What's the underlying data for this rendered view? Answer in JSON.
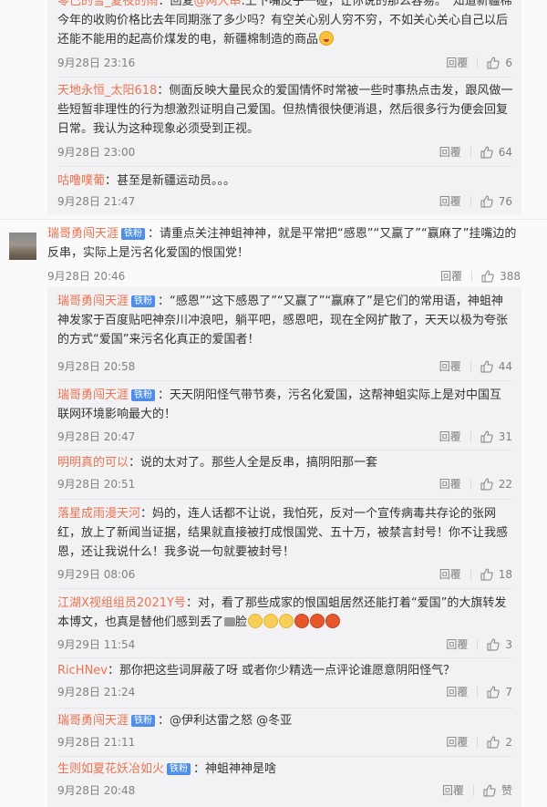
{
  "comments_top": [
    {
      "user": "零已的雪_夏夜的雨",
      "text_parts": [
        "：回复",
        "@网大串",
        ":上下嘴皮子一碰，让你说的那么容易。“知道新疆棉今年的收购价格比去年同期涨了多少吗？有空关心别人穷不穷，不如关心关心自己以后还能不能用的起高价煤发的电，新疆棉制造的商品"
      ],
      "emoji": "laugh-emoji",
      "time": "9月28日 23:16",
      "reply_label": "回覆",
      "likes": "6"
    },
    {
      "user": "天地永恒_太阳618",
      "text": "：侧面反映大量民众的爱国情怀时常被一些时事热点击发，跟风做一些短暂非理性的行为想激烈证明自己爱国。但热情很快便消退，然后很多行为便会回复日常。我认为这种现象必须受到正视。",
      "time": "9月28日 23:00",
      "reply_label": "回覆",
      "likes": "64"
    },
    {
      "user": "咕噜噗葡",
      "text": "：甚至是新疆运动员。。。",
      "time": "9月28日 21:47",
      "reply_label": "回覆",
      "likes": "76"
    }
  ],
  "main_comment": {
    "user": "瑞哥勇闯天涯",
    "badge": "铁粉",
    "text": "：请重点关注神蛆神神，就是平常把“感恩”“又赢了”“赢麻了”挂嘴边的反串，实际上是污名化爱国的恨国党！",
    "time": "9月28日 20:46",
    "reply_label": "回覆",
    "likes": "388"
  },
  "replies": [
    {
      "user": "瑞哥勇闯天涯",
      "badge": "铁粉",
      "text": "：“感恩”“这下感恩了”“又赢了”“赢麻了”是它们的常用语，神蛆神神发家于百度贴吧神奈川冲浪吧，躺平吧，感恩吧，现在全网扩散了，天天以极为夸张的方式“爱国”来污名化真正的爱国者！",
      "time": "9月28日 20:58",
      "reply_label": "回覆",
      "likes": "44"
    },
    {
      "user": "瑞哥勇闯天涯",
      "badge": "铁粉",
      "text": "：天天阴阳怪气带节奏，污名化爱国，这帮神蛆实际上是对中国互联网环境影响最大的！",
      "time": "9月28日 20:47",
      "reply_label": "回覆",
      "likes": "31"
    },
    {
      "user": "明明真的可以",
      "text": "：说的太对了。那些人全是反串，搞阴阳那一套",
      "time": "9月28日 20:51",
      "reply_label": "回覆",
      "likes": "22"
    },
    {
      "user": "落星成雨漫天河",
      "text": "：妈的，连人话都不让说，我怕死，反对一个宣传病毒共存论的张网红，放上了新闻当证据，结果就直接被打成恨国党、五十万，被禁言封号！你不让我感恩，还让我说什么！我多说一句就要被封号！",
      "time": "9月29日 08:06",
      "reply_label": "回覆",
      "likes": "18"
    },
    {
      "user": "江湖X视组组员2021Y号",
      "text": "：对，看了那些成家的恨国蛆居然还能打着“爱国”的大旗转发本博文，也真是替他们感到丢了",
      "text_tail": "脸",
      "time": "9月29日 11:54",
      "reply_label": "回覆",
      "likes": "3"
    },
    {
      "user": "RicHNev",
      "text": "：那你把这些词屏蔽了呀 或者你少精选一点评论谁愿意阴阳怪气？",
      "time": "9月28日 21:24",
      "reply_label": "回覆",
      "likes": "7"
    },
    {
      "user": "瑞哥勇闯天涯",
      "badge": "铁粉",
      "text": "：@伊利达雷之怒 @冬亚",
      "time": "9月28日 21:11",
      "reply_label": "回覆",
      "likes": "2"
    },
    {
      "user": "生则如夏花妖冶如火",
      "badge": "铁粉",
      "text": "：神蛆神神是啥",
      "time": "9月28日 20:48",
      "reply_label": "回覆",
      "likes": "赞"
    }
  ],
  "icons": {
    "like": "thumbs-up-icon",
    "avatar": "user-avatar-landscape"
  },
  "colors": {
    "username": "#eb7350",
    "badge": "#4e8ee8",
    "meta": "#808080",
    "panel": "#f2f2f5"
  }
}
